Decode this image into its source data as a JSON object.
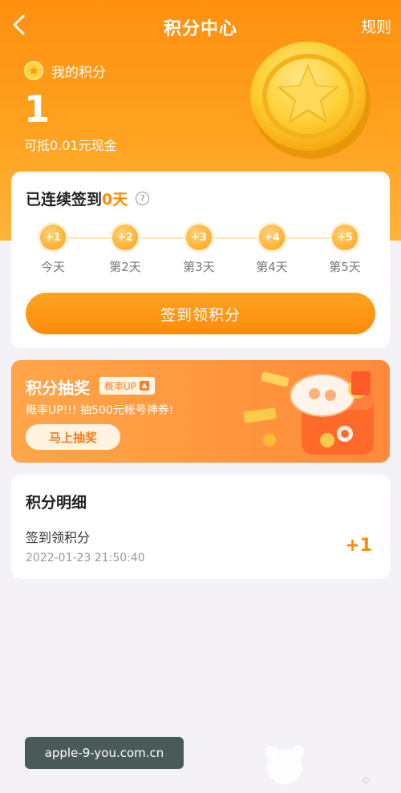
{
  "header": {
    "title": "积分中心",
    "rules_label": "规则",
    "back_icon": "chevron-left-icon"
  },
  "points": {
    "label": "我的积分",
    "value": "1",
    "cash_text": "可抵0.01元现金"
  },
  "checkin": {
    "streak_prefix": "已连续签到",
    "streak_days": "0天",
    "days": [
      {
        "reward": "+1",
        "label": "今天"
      },
      {
        "reward": "+2",
        "label": "第2天"
      },
      {
        "reward": "+3",
        "label": "第3天"
      },
      {
        "reward": "+4",
        "label": "第4天"
      },
      {
        "reward": "+5",
        "label": "第5天"
      }
    ],
    "button_label": "签到领积分"
  },
  "lottery": {
    "title": "积分抽奖",
    "badge": "概率UP",
    "subtitle": "概率UP!!! 抽500元帐号神券!",
    "button_label": "马上抽奖"
  },
  "details": {
    "title": "积分明细",
    "records": [
      {
        "name": "签到领积分",
        "time": "2022-01-23 21:50:40",
        "points": "+1"
      }
    ]
  },
  "watermark": "apple-9-you.com.cn",
  "colors": {
    "accent": "#ff8a00",
    "hero_top": "#ff8f0f",
    "page_bg": "#f4f2f7"
  }
}
